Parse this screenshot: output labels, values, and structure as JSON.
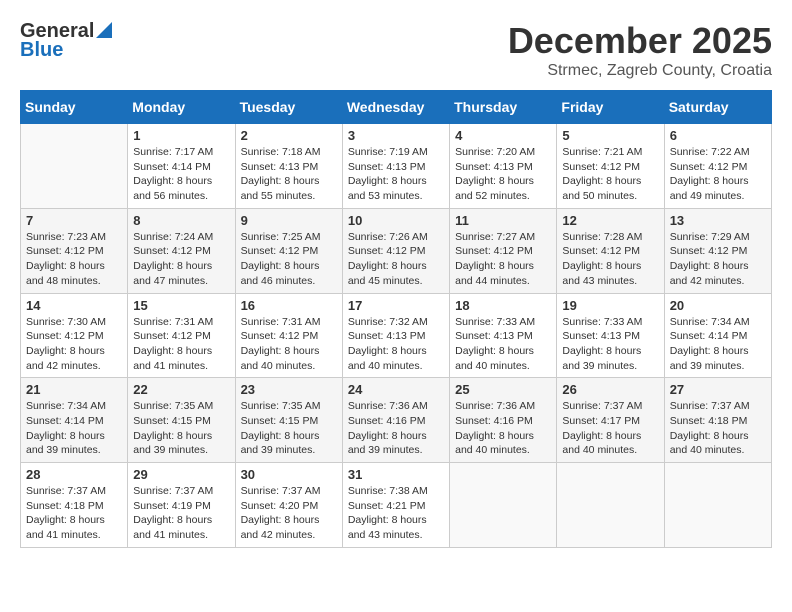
{
  "header": {
    "logo_general": "General",
    "logo_blue": "Blue",
    "month": "December 2025",
    "location": "Strmec, Zagreb County, Croatia"
  },
  "days_of_week": [
    "Sunday",
    "Monday",
    "Tuesday",
    "Wednesday",
    "Thursday",
    "Friday",
    "Saturday"
  ],
  "weeks": [
    [
      {
        "day": "",
        "content": ""
      },
      {
        "day": "1",
        "content": "Sunrise: 7:17 AM\nSunset: 4:14 PM\nDaylight: 8 hours\nand 56 minutes."
      },
      {
        "day": "2",
        "content": "Sunrise: 7:18 AM\nSunset: 4:13 PM\nDaylight: 8 hours\nand 55 minutes."
      },
      {
        "day": "3",
        "content": "Sunrise: 7:19 AM\nSunset: 4:13 PM\nDaylight: 8 hours\nand 53 minutes."
      },
      {
        "day": "4",
        "content": "Sunrise: 7:20 AM\nSunset: 4:13 PM\nDaylight: 8 hours\nand 52 minutes."
      },
      {
        "day": "5",
        "content": "Sunrise: 7:21 AM\nSunset: 4:12 PM\nDaylight: 8 hours\nand 50 minutes."
      },
      {
        "day": "6",
        "content": "Sunrise: 7:22 AM\nSunset: 4:12 PM\nDaylight: 8 hours\nand 49 minutes."
      }
    ],
    [
      {
        "day": "7",
        "content": "Sunrise: 7:23 AM\nSunset: 4:12 PM\nDaylight: 8 hours\nand 48 minutes."
      },
      {
        "day": "8",
        "content": "Sunrise: 7:24 AM\nSunset: 4:12 PM\nDaylight: 8 hours\nand 47 minutes."
      },
      {
        "day": "9",
        "content": "Sunrise: 7:25 AM\nSunset: 4:12 PM\nDaylight: 8 hours\nand 46 minutes."
      },
      {
        "day": "10",
        "content": "Sunrise: 7:26 AM\nSunset: 4:12 PM\nDaylight: 8 hours\nand 45 minutes."
      },
      {
        "day": "11",
        "content": "Sunrise: 7:27 AM\nSunset: 4:12 PM\nDaylight: 8 hours\nand 44 minutes."
      },
      {
        "day": "12",
        "content": "Sunrise: 7:28 AM\nSunset: 4:12 PM\nDaylight: 8 hours\nand 43 minutes."
      },
      {
        "day": "13",
        "content": "Sunrise: 7:29 AM\nSunset: 4:12 PM\nDaylight: 8 hours\nand 42 minutes."
      }
    ],
    [
      {
        "day": "14",
        "content": "Sunrise: 7:30 AM\nSunset: 4:12 PM\nDaylight: 8 hours\nand 42 minutes."
      },
      {
        "day": "15",
        "content": "Sunrise: 7:31 AM\nSunset: 4:12 PM\nDaylight: 8 hours\nand 41 minutes."
      },
      {
        "day": "16",
        "content": "Sunrise: 7:31 AM\nSunset: 4:12 PM\nDaylight: 8 hours\nand 40 minutes."
      },
      {
        "day": "17",
        "content": "Sunrise: 7:32 AM\nSunset: 4:13 PM\nDaylight: 8 hours\nand 40 minutes."
      },
      {
        "day": "18",
        "content": "Sunrise: 7:33 AM\nSunset: 4:13 PM\nDaylight: 8 hours\nand 40 minutes."
      },
      {
        "day": "19",
        "content": "Sunrise: 7:33 AM\nSunset: 4:13 PM\nDaylight: 8 hours\nand 39 minutes."
      },
      {
        "day": "20",
        "content": "Sunrise: 7:34 AM\nSunset: 4:14 PM\nDaylight: 8 hours\nand 39 minutes."
      }
    ],
    [
      {
        "day": "21",
        "content": "Sunrise: 7:34 AM\nSunset: 4:14 PM\nDaylight: 8 hours\nand 39 minutes."
      },
      {
        "day": "22",
        "content": "Sunrise: 7:35 AM\nSunset: 4:15 PM\nDaylight: 8 hours\nand 39 minutes."
      },
      {
        "day": "23",
        "content": "Sunrise: 7:35 AM\nSunset: 4:15 PM\nDaylight: 8 hours\nand 39 minutes."
      },
      {
        "day": "24",
        "content": "Sunrise: 7:36 AM\nSunset: 4:16 PM\nDaylight: 8 hours\nand 39 minutes."
      },
      {
        "day": "25",
        "content": "Sunrise: 7:36 AM\nSunset: 4:16 PM\nDaylight: 8 hours\nand 40 minutes."
      },
      {
        "day": "26",
        "content": "Sunrise: 7:37 AM\nSunset: 4:17 PM\nDaylight: 8 hours\nand 40 minutes."
      },
      {
        "day": "27",
        "content": "Sunrise: 7:37 AM\nSunset: 4:18 PM\nDaylight: 8 hours\nand 40 minutes."
      }
    ],
    [
      {
        "day": "28",
        "content": "Sunrise: 7:37 AM\nSunset: 4:18 PM\nDaylight: 8 hours\nand 41 minutes."
      },
      {
        "day": "29",
        "content": "Sunrise: 7:37 AM\nSunset: 4:19 PM\nDaylight: 8 hours\nand 41 minutes."
      },
      {
        "day": "30",
        "content": "Sunrise: 7:37 AM\nSunset: 4:20 PM\nDaylight: 8 hours\nand 42 minutes."
      },
      {
        "day": "31",
        "content": "Sunrise: 7:38 AM\nSunset: 4:21 PM\nDaylight: 8 hours\nand 43 minutes."
      },
      {
        "day": "",
        "content": ""
      },
      {
        "day": "",
        "content": ""
      },
      {
        "day": "",
        "content": ""
      }
    ]
  ]
}
